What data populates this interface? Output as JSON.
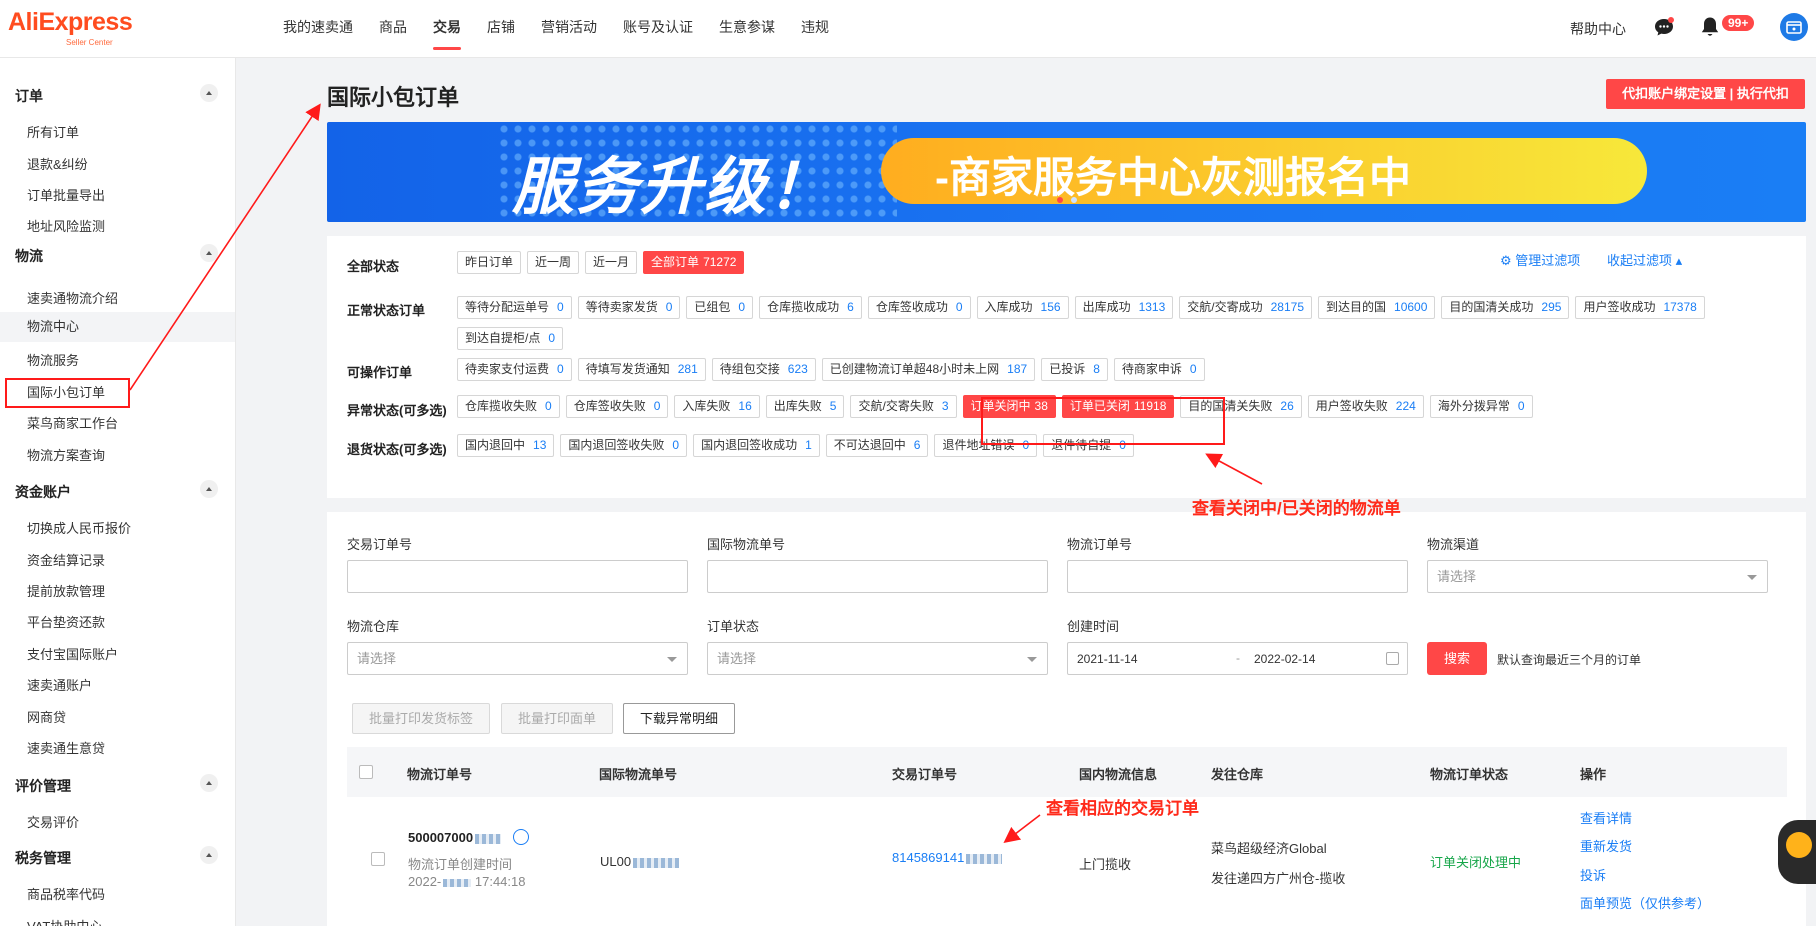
{
  "logo": {
    "name": "AliExpress",
    "sub": "Seller Center"
  },
  "topnav": [
    "我的速卖通",
    "商品",
    "交易",
    "店铺",
    "营销活动",
    "账号及认证",
    "生意参谋",
    "违规"
  ],
  "header": {
    "help": "帮助中心",
    "badge": "99+"
  },
  "sidebar": {
    "groups": [
      {
        "title": "订单",
        "items": [
          "所有订单",
          "退款&纠纷",
          "订单批量导出",
          "地址风险监测"
        ]
      },
      {
        "title": "物流",
        "items": [
          "速卖通物流介绍",
          "物流中心",
          "物流服务",
          "国际小包订单",
          "菜鸟商家工作台",
          "物流方案查询"
        ]
      },
      {
        "title": "资金账户",
        "items": [
          "切换成人民币报价",
          "资金结算记录",
          "提前放款管理",
          "平台垫资还款",
          "支付宝国际账户",
          "速卖通账户",
          "网商贷",
          "速卖通生意贷"
        ]
      },
      {
        "title": "评价管理",
        "items": [
          "交易评价"
        ]
      },
      {
        "title": "税务管理",
        "items": [
          "商品税率代码",
          "VAT协助中心"
        ]
      }
    ]
  },
  "page": {
    "title": "国际小包订单",
    "withhold_button": "代扣账户绑定设置 | 执行代扣"
  },
  "banner": {
    "main": "服务升级！",
    "sub": "-商家服务中心灰测报名中"
  },
  "filters": {
    "manage": "管理过滤项",
    "collapse": "收起过滤项",
    "all": {
      "label": "全部状态",
      "chips": [
        {
          "text": "昨日订单",
          "count": ""
        },
        {
          "text": "近一周",
          "count": ""
        },
        {
          "text": "近一月",
          "count": ""
        },
        {
          "text": "全部订单",
          "count": "71272",
          "active": true
        }
      ]
    },
    "normal": {
      "label": "正常状态订单",
      "chips": [
        {
          "text": "等待分配运单号",
          "count": "0"
        },
        {
          "text": "等待卖家发货",
          "count": "0"
        },
        {
          "text": "已组包",
          "count": "0"
        },
        {
          "text": "仓库揽收成功",
          "count": "6"
        },
        {
          "text": "仓库签收成功",
          "count": "0"
        },
        {
          "text": "入库成功",
          "count": "156"
        },
        {
          "text": "出库成功",
          "count": "1313"
        },
        {
          "text": "交航/交寄成功",
          "count": "28175"
        },
        {
          "text": "到达目的国",
          "count": "10600"
        },
        {
          "text": "目的国清关成功",
          "count": "295"
        },
        {
          "text": "用户签收成功",
          "count": "17378"
        },
        {
          "text": "到达自提柜/点",
          "count": "0"
        }
      ]
    },
    "operable": {
      "label": "可操作订单",
      "chips": [
        {
          "text": "待卖家支付运费",
          "count": "0"
        },
        {
          "text": "待填写发货通知",
          "count": "281"
        },
        {
          "text": "待组包交接",
          "count": "623"
        },
        {
          "text": "已创建物流订单超48小时未上网",
          "count": "187"
        },
        {
          "text": "已投诉",
          "count": "8"
        },
        {
          "text": "待商家申诉",
          "count": "0"
        }
      ]
    },
    "abnormal": {
      "label": "异常状态(可多选)",
      "chips": [
        {
          "text": "仓库揽收失败",
          "count": "0"
        },
        {
          "text": "仓库签收失败",
          "count": "0"
        },
        {
          "text": "入库失败",
          "count": "16"
        },
        {
          "text": "出库失败",
          "count": "5"
        },
        {
          "text": "交航/交寄失败",
          "count": "3"
        },
        {
          "text": "订单关闭中",
          "count": "38",
          "active": true
        },
        {
          "text": "订单已关闭",
          "count": "11918",
          "active": true
        },
        {
          "text": "目的国清关失败",
          "count": "26"
        },
        {
          "text": "用户签收失败",
          "count": "224"
        },
        {
          "text": "海外分拨异常",
          "count": "0"
        }
      ]
    },
    "return": {
      "label": "退货状态(可多选)",
      "chips": [
        {
          "text": "国内退回中",
          "count": "13"
        },
        {
          "text": "国内退回签收失败",
          "count": "0"
        },
        {
          "text": "国内退回签收成功",
          "count": "1"
        },
        {
          "text": "不可达退回中",
          "count": "6"
        },
        {
          "text": "退件地址错误",
          "count": "0"
        },
        {
          "text": "退件待自提",
          "count": "0"
        }
      ]
    }
  },
  "search": {
    "labels": [
      "交易订单号",
      "国际物流单号",
      "物流订单号",
      "物流渠道",
      "物流仓库",
      "订单状态",
      "创建时间"
    ],
    "placeholder": "请选择",
    "date_start": "2021-11-14",
    "date_sep": "-",
    "date_end": "2022-02-14",
    "search_button": "搜索",
    "hint": "默认查询最近三个月的订单",
    "batch_print_label": "批量打印发货标签",
    "batch_print_sheet": "批量打印面单",
    "download_abnormal": "下载异常明细"
  },
  "table": {
    "headers": [
      "物流订单号",
      "国际物流单号",
      "交易订单号",
      "国内物流信息",
      "发往仓库",
      "物流订单状态",
      "操作"
    ],
    "row": {
      "logistics_no": "500007000",
      "created_label": "物流订单创建时间",
      "created_prefix": "2022-",
      "created_time": "17:44:18",
      "intl_no": "UL00",
      "trade_no": "8145869141",
      "domestic": "上门揽收",
      "warehouse_1": "菜鸟超级经济Global",
      "warehouse_2": "发往递四方广州仓-揽收",
      "status": "订单关闭处理中",
      "actions": [
        "查看详情",
        "重新发货",
        "投诉",
        "面单预览（仅供参考）"
      ]
    }
  },
  "annotations": {
    "closed_orders": "查看关闭中/已关闭的物流单",
    "trade_order": "查看相应的交易订单"
  },
  "colors": {
    "accent": "#ff4747",
    "link": "#1a7ef5",
    "status_green": "#17a64a",
    "annotation": "#ff1a1a"
  }
}
